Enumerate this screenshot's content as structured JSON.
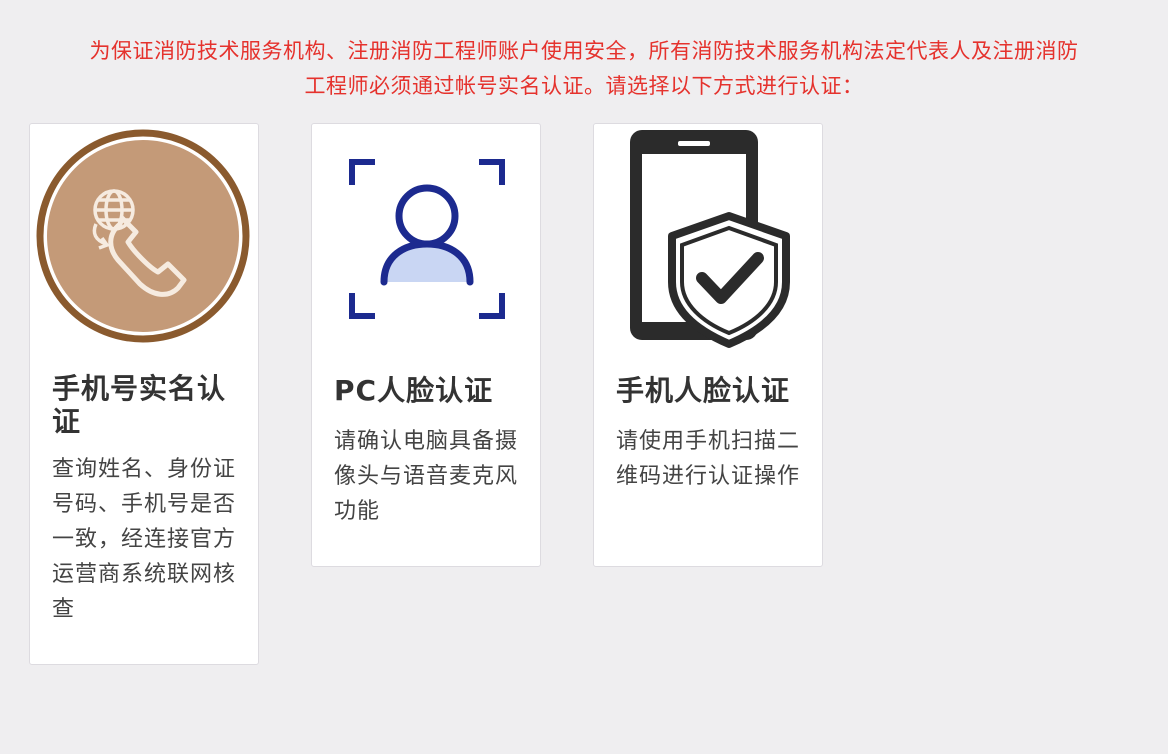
{
  "notice": {
    "line1": "为保证消防技术服务机构、注册消防工程师账户使用安全，所有消防技术服务机构法定代表人及注册消防",
    "line2": "工程师必须通过帐号实名认证。请选择以下方式进行认证："
  },
  "options": [
    {
      "icon": "phone-call-icon",
      "title": "手机号实名认证",
      "desc": "查询姓名、身份证号码、手机号是否一致，经连接官方运营商系统联网核查"
    },
    {
      "icon": "face-scan-icon",
      "title": "PC人脸认证",
      "desc": "请确认电脑具备摄像头与语音麦克风功能"
    },
    {
      "icon": "mobile-shield-check-icon",
      "title": "手机人脸认证",
      "desc": "请使用手机扫描二维码进行认证操作"
    }
  ],
  "colors": {
    "notice": "#e5322d",
    "phone_icon_ring": "#8a5a2e",
    "phone_icon_fill": "#c49a78",
    "face_icon_blue": "#1c2a8f",
    "face_icon_light": "#c9d6f3",
    "mobile_icon_dark": "#2b2b2b"
  }
}
